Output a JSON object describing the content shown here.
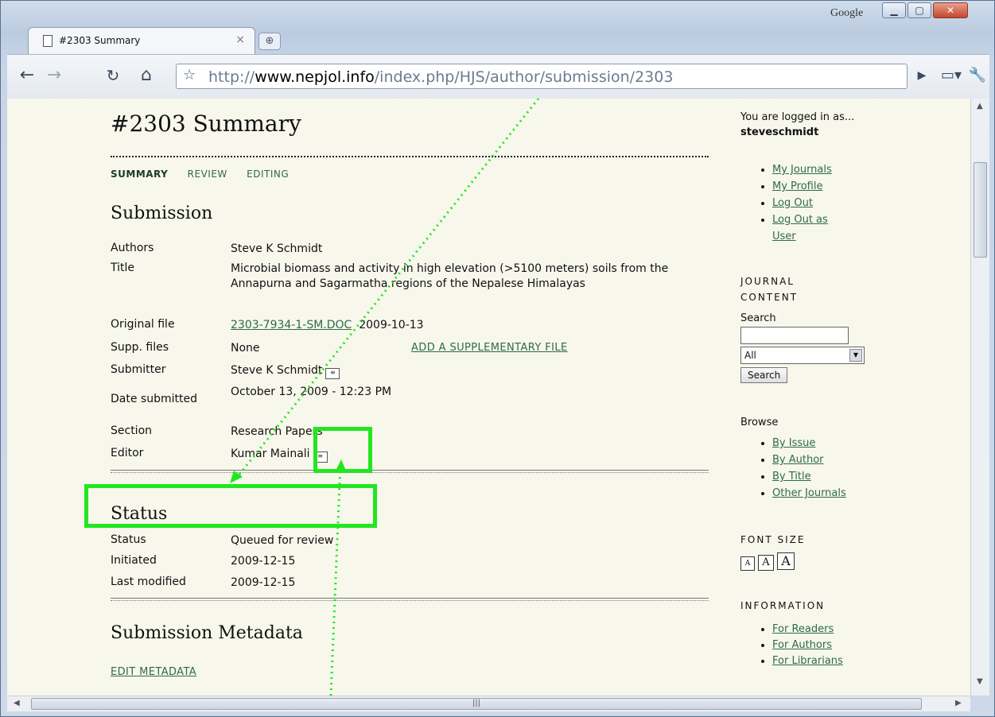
{
  "browser": {
    "google_label": "Google",
    "tab_title": "#2303 Summary",
    "tab_close": "×",
    "url_prefix": "http://",
    "url_host": "www.nepjol.info",
    "url_path": "/index.php/HJS/author/submission/2303"
  },
  "page": {
    "title": "#2303 Summary",
    "nav": [
      "SUMMARY",
      "REVIEW",
      "EDITING"
    ],
    "submission": {
      "heading": "Submission",
      "authors_label": "Authors",
      "authors": "Steve K Schmidt",
      "title_label": "Title",
      "title": "Microbial biomass and activity in high elevation (>5100 meters) soils from the Annapurna and Sagarmatha regions of the Nepalese Himalayas",
      "original_file_label": "Original file",
      "original_file": "2303-7934-1-SM.DOC",
      "original_file_date": "2009-10-13",
      "supp_files_label": "Supp. files",
      "supp_files": "None",
      "add_supp": "ADD A SUPPLEMENTARY FILE",
      "submitter_label": "Submitter",
      "submitter": "Steve K Schmidt",
      "date_label": "Date submitted",
      "date": "October 13, 2009 - 12:23 PM",
      "section_label": "Section",
      "section": "Research Papers",
      "editor_label": "Editor",
      "editor": "Kumar Mainali"
    },
    "status": {
      "heading": "Status",
      "status_label": "Status",
      "status": "Queued for review",
      "initiated_label": "Initiated",
      "initiated": "2009-12-15",
      "modified_label": "Last modified",
      "modified": "2009-12-15"
    },
    "metadata": {
      "heading": "Submission Metadata",
      "edit": "EDIT METADATA"
    }
  },
  "sidebar": {
    "logged_in": "You are logged in as...",
    "username": "steveschmidt",
    "user_links": [
      "My Journals",
      "My Profile",
      "Log Out",
      "Log Out as User"
    ],
    "journal_content": "JOURNAL CONTENT",
    "search_label": "Search",
    "search_scope": "All",
    "search_button": "Search",
    "browse_label": "Browse",
    "browse_links": [
      "By Issue",
      "By Author",
      "By Title",
      "Other Journals"
    ],
    "font_size": "FONT SIZE",
    "font_buttons": [
      "A",
      "A",
      "A"
    ],
    "information": "INFORMATION",
    "info_links": [
      "For Readers",
      "For Authors",
      "For Librarians"
    ]
  },
  "colors": {
    "highlight": "#22e61f",
    "link": "#2f6b4a"
  }
}
